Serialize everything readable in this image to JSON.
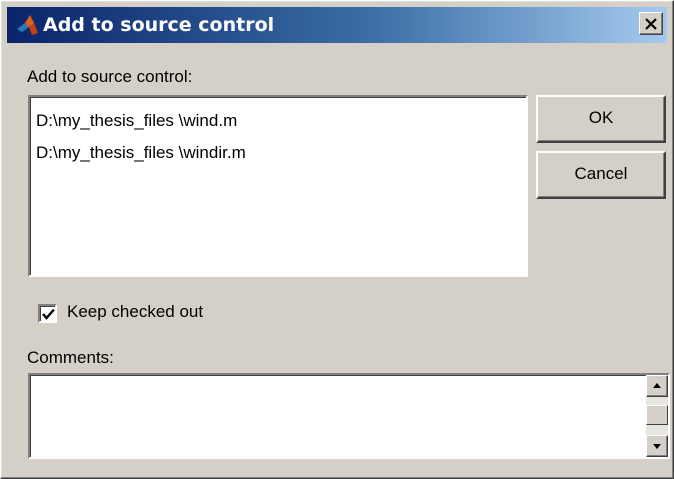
{
  "window": {
    "title": "Add to source control",
    "close_glyph": "✕"
  },
  "list_label": "Add to source control:",
  "files": [
    "D:\\my_thesis_files \\wind.m",
    "D:\\my_thesis_files \\windir.m"
  ],
  "buttons": {
    "ok_label": "OK",
    "cancel_label": "Cancel"
  },
  "keep_checked_out": {
    "label": "Keep checked out",
    "checked": true
  },
  "comments": {
    "label": "Comments:",
    "value": ""
  },
  "icons": {
    "title": "matlab-logo-icon",
    "close": "close-icon",
    "scroll_up": "arrow-up-icon",
    "scroll_down": "arrow-down-icon"
  },
  "colors": {
    "title_gradient_start": "#0a246a",
    "title_gradient_end": "#a6caf0",
    "dialog_bg": "#d4d0c8"
  }
}
